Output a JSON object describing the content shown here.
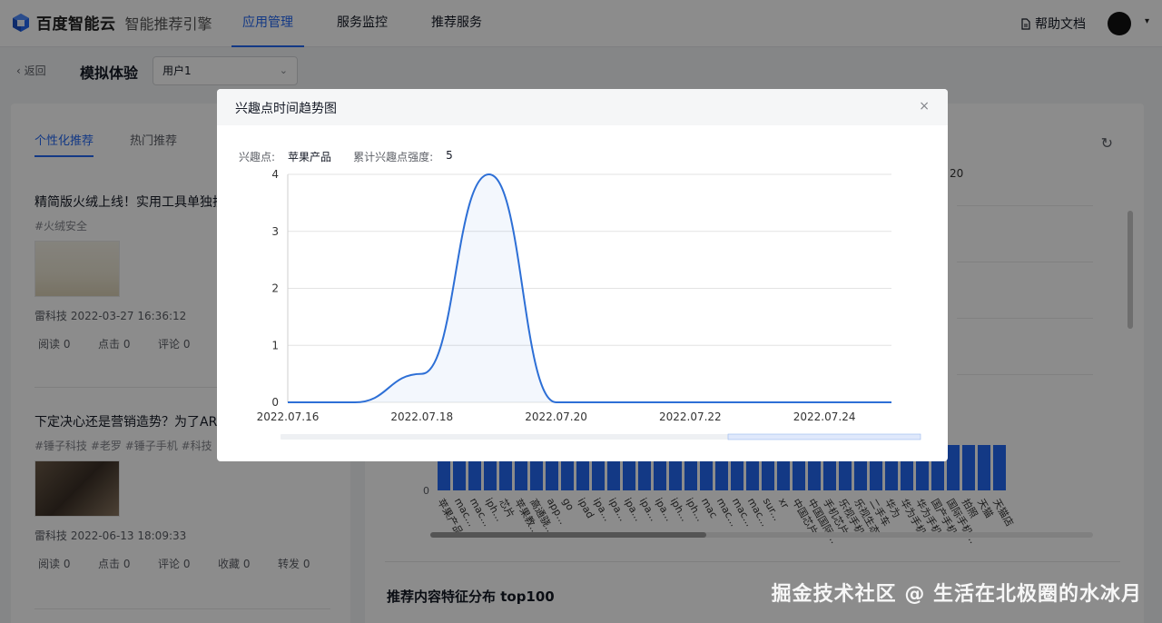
{
  "app": {
    "brand": "百度智能云",
    "product": "智能推荐引擎",
    "nav": [
      "应用管理",
      "服务监控",
      "推荐服务"
    ],
    "active_nav": 0,
    "help": "帮助文档"
  },
  "subheader": {
    "back": "返回",
    "title": "模拟体验",
    "user_select": "用户1"
  },
  "left": {
    "tabs": [
      "个性化推荐",
      "热门推荐"
    ],
    "articles": [
      {
        "title": "精简版火绒上线！实用工具单独拆分，轻量到极致",
        "tags": "#火绒安全",
        "author_time": "雷科技  2022-03-27 16:36:12",
        "stats": [
          "阅读 0",
          "点击 0",
          "评论 0"
        ]
      },
      {
        "title": "下定决心还是营销造势？为了AR，罗永浩再退网！",
        "tags": "#锤子科技 #老罗 #锤子手机 #科技",
        "author_time": "雷科技  2022-06-13 18:09:33",
        "stats": [
          "阅读 0",
          "点击 0",
          "评论 0",
          "收藏 0",
          "转发 0"
        ]
      }
    ]
  },
  "right": {
    "partial_label": "20",
    "zero_label": "0",
    "bar_labels": [
      "苹果产品",
      "mac...",
      "mac...",
      "iph...",
      "芯片",
      "苹果教...",
      "高通骁...",
      "app...",
      "go",
      "ipad",
      "ipa...",
      "ipa...",
      "ipa...",
      "ipa...",
      "ipa...",
      "iph...",
      "iph...",
      "mac",
      "mac...",
      "mac...",
      "mac...",
      "sur...",
      "xr",
      "中国芯片",
      "中国国际...",
      "手机芯片",
      "乐视手机",
      "乐视生态",
      "二手车",
      "华为",
      "华为手机",
      "华为手机",
      "国产手机",
      "国际手机...",
      "拍照",
      "天猫",
      "天猫店"
    ],
    "section_title": "推荐内容特征分布 top100"
  },
  "modal": {
    "title": "兴趣点时间趋势图",
    "close": "×",
    "interest_label": "兴趣点:",
    "interest_value": "苹果产品",
    "strength_label": "累计兴趣点强度:",
    "strength_value": "5"
  },
  "chart_data": {
    "type": "area",
    "title": "",
    "xlabel": "",
    "ylabel": "",
    "x_ticks": [
      "2022.07.16",
      "2022.07.18",
      "2022.07.20",
      "2022.07.22",
      "2022.07.24"
    ],
    "y_ticks": [
      0,
      1,
      2,
      3,
      4
    ],
    "ylim": [
      0,
      4
    ],
    "xlim": [
      "2022.07.16",
      "2022.07.25"
    ],
    "grid": true,
    "series": [
      {
        "x": [
          "2022.07.16",
          "2022.07.17",
          "2022.07.18",
          "2022.07.19",
          "2022.07.20",
          "2022.07.21",
          "2022.07.22",
          "2022.07.23",
          "2022.07.24",
          "2022.07.25"
        ],
        "values": [
          0,
          0,
          0.5,
          4,
          0,
          0,
          0,
          0,
          0,
          0
        ],
        "color": "#2d6fd6"
      }
    ]
  },
  "watermark": "掘金技术社区 @ 生活在北极圈的水冰月"
}
